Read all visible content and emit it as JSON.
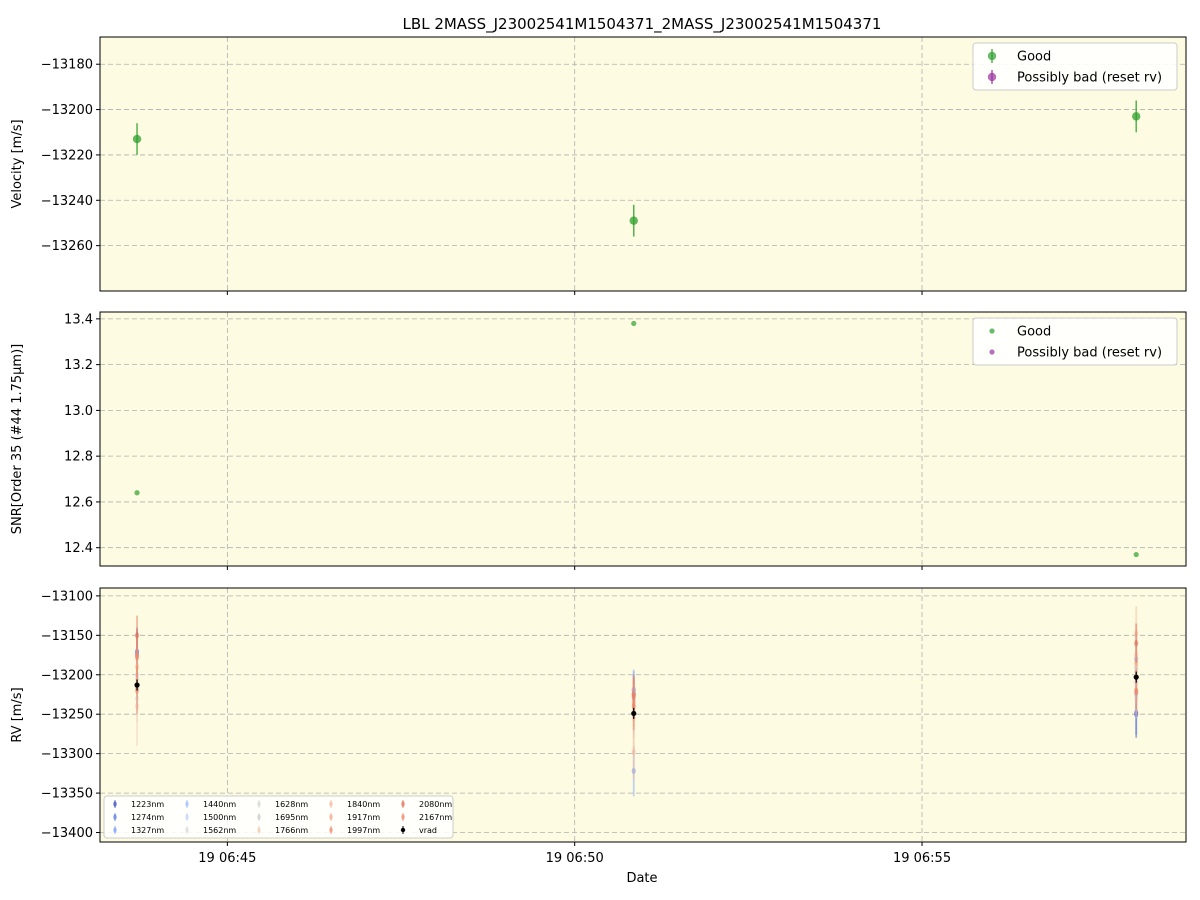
{
  "title": "LBL 2MASS_J23002541M1504371_2MASS_J23002541M1504371",
  "xlabel": "Date",
  "x_ticks": [
    "19 06:45",
    "19 06:50",
    "19 06:55"
  ],
  "colors": {
    "background": "#fdfbe1",
    "good": "#2ca02c",
    "bad": "#9b30a0",
    "vrad": "#000000",
    "grid": "#b0b0b0"
  },
  "chart_data": [
    {
      "type": "scatter",
      "ylabel": "Velocity [m/s]",
      "ylim": [
        -13280,
        -13168
      ],
      "yticks": [
        -13180,
        -13200,
        -13220,
        -13240,
        -13260
      ],
      "ytick_labels": [
        "−13180",
        "−13200",
        "−13220",
        "−13240",
        "−13260"
      ],
      "grid": true,
      "legend": {
        "position": "top-right",
        "entries": [
          "Good",
          "Possibly bad (reset rv)"
        ]
      },
      "series": [
        {
          "name": "Good",
          "points": [
            {
              "x": "06:43:42",
              "y": -13213,
              "err": 7
            },
            {
              "x": "06:50:51",
              "y": -13249,
              "err": 7
            },
            {
              "x": "06:58:05",
              "y": -13203,
              "err": 7
            }
          ]
        },
        {
          "name": "Possibly bad (reset rv)",
          "points": []
        }
      ]
    },
    {
      "type": "scatter",
      "ylabel": "SNR[Order 35 (#44 1.75μm)]",
      "ylim": [
        12.32,
        13.43
      ],
      "yticks": [
        12.4,
        12.6,
        12.8,
        13.0,
        13.2,
        13.4
      ],
      "ytick_labels": [
        "12.4",
        "12.6",
        "12.8",
        "13.0",
        "13.2",
        "13.4"
      ],
      "grid": true,
      "legend": {
        "position": "top-right",
        "entries": [
          "Good",
          "Possibly bad (reset rv)"
        ]
      },
      "series": [
        {
          "name": "Good",
          "points": [
            {
              "x": "06:43:42",
              "y": 12.64
            },
            {
              "x": "06:50:51",
              "y": 13.38
            },
            {
              "x": "06:58:05",
              "y": 12.37
            }
          ]
        },
        {
          "name": "Possibly bad (reset rv)",
          "points": []
        }
      ]
    },
    {
      "type": "scatter",
      "ylabel": "RV [m/s]",
      "ylim": [
        -13412,
        -13090
      ],
      "yticks": [
        -13100,
        -13150,
        -13200,
        -13250,
        -13300,
        -13350,
        -13400
      ],
      "ytick_labels": [
        "−13100",
        "−13150",
        "−13200",
        "−13250",
        "−13300",
        "−13350",
        "−13400"
      ],
      "grid": true,
      "legend": {
        "position": "bottom-left",
        "columns": 5
      },
      "series": [
        {
          "name": "1223nm",
          "color": "#3b4cc0",
          "y": [
            -13172,
            -13225,
            -13250
          ],
          "err": [
            30,
            25,
            30
          ]
        },
        {
          "name": "1274nm",
          "color": "#5977e3",
          "y": [
            -13175,
            -13220,
            -13248
          ],
          "err": [
            28,
            25,
            28
          ]
        },
        {
          "name": "1327nm",
          "color": "#7b9ff9",
          "y": [
            -13170,
            -13322,
            -13180
          ],
          "err": [
            30,
            32,
            30
          ]
        },
        {
          "name": "1440nm",
          "color": "#9ebeff",
          "y": [
            -13215,
            -13218,
            -13225
          ],
          "err": [
            30,
            25,
            25
          ]
        },
        {
          "name": "1500nm",
          "color": "#c0d4f5",
          "y": [
            -13200,
            -13232,
            -13210
          ],
          "err": [
            25,
            22,
            25
          ]
        },
        {
          "name": "1562nm",
          "color": "#dddcdc",
          "y": [
            -13230,
            -13245,
            -13230
          ],
          "err": [
            30,
            30,
            25
          ]
        },
        {
          "name": "1628nm",
          "color": "#d5d5d5",
          "y": [
            -13205,
            -13240,
            -13195
          ],
          "err": [
            30,
            30,
            25
          ]
        },
        {
          "name": "1695nm",
          "color": "#cccccc",
          "y": [
            -13215,
            -13250,
            -13190
          ],
          "err": [
            30,
            30,
            25
          ]
        },
        {
          "name": "1766nm",
          "color": "#f2cbb7",
          "y": [
            -13240,
            -13255,
            -13175
          ],
          "err": [
            50,
            40,
            40
          ]
        },
        {
          "name": "1840nm",
          "color": "#f7b89c",
          "y": [
            -13190,
            -13298,
            -13148
          ],
          "err": [
            40,
            35,
            35
          ]
        },
        {
          "name": "1917nm",
          "color": "#f7a889",
          "y": [
            -13175,
            -13235,
            -13185
          ],
          "err": [
            35,
            30,
            30
          ]
        },
        {
          "name": "1997nm",
          "color": "#f08a6c",
          "y": [
            -13220,
            -13240,
            -13222
          ],
          "err": [
            30,
            30,
            30
          ]
        },
        {
          "name": "2080nm",
          "color": "#e36c55",
          "y": [
            -13150,
            -13228,
            -13160
          ],
          "err": [
            25,
            25,
            25
          ]
        },
        {
          "name": "2167nm",
          "color": "#ee8468",
          "y": [
            -13178,
            -13225,
            -13220
          ],
          "err": [
            25,
            25,
            25
          ]
        },
        {
          "name": "vrad",
          "color": "#000000",
          "y": [
            -13213,
            -13249,
            -13203
          ],
          "err": [
            7,
            7,
            7
          ]
        }
      ]
    }
  ]
}
